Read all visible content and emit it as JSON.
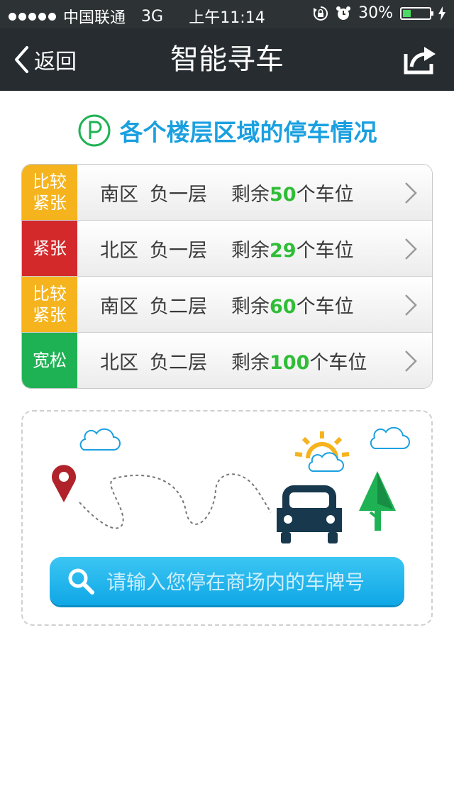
{
  "status_bar": {
    "carrier": "中国联通",
    "network": "3G",
    "time": "上午11:14",
    "battery_percent": "30%",
    "battery_level": 0.3,
    "icons": [
      "signal-dots-icon",
      "rotation-lock-icon",
      "alarm-icon",
      "battery-icon",
      "charging-bolt-icon"
    ]
  },
  "nav": {
    "back_label": "返回",
    "title": "智能寻车",
    "back_icon": "chevron-left-icon",
    "share_icon": "share-icon"
  },
  "heading": {
    "icon": "parking-icon",
    "text": "各个楼层区域的停车情况",
    "color": "#1aa0e0"
  },
  "floors": [
    {
      "status": "比较紧张",
      "status_color": "#f5b31d",
      "area": "南区",
      "floor": "负一层",
      "prefix": "剩余",
      "count": "50",
      "suffix": "个车位"
    },
    {
      "status": "紧张",
      "status_color": "#d3292b",
      "area": "北区",
      "floor": "负一层",
      "prefix": "剩余",
      "count": "29",
      "suffix": "个车位"
    },
    {
      "status": "比较紧张",
      "status_color": "#f5b31d",
      "area": "南区",
      "floor": "负二层",
      "prefix": "剩余",
      "count": "60",
      "suffix": "个车位"
    },
    {
      "status": "宽松",
      "status_color": "#1fb254",
      "area": "北区",
      "floor": "负二层",
      "prefix": "剩余",
      "count": "100",
      "suffix": "个车位"
    }
  ],
  "search": {
    "placeholder": "请输入您停在商场内的车牌号",
    "icon": "search-icon"
  },
  "colors": {
    "status_bar_bg": "#2d3235",
    "nav_bg": "#262c30",
    "count_green": "#2fbd37",
    "search_blue": "#1fb2ee"
  }
}
